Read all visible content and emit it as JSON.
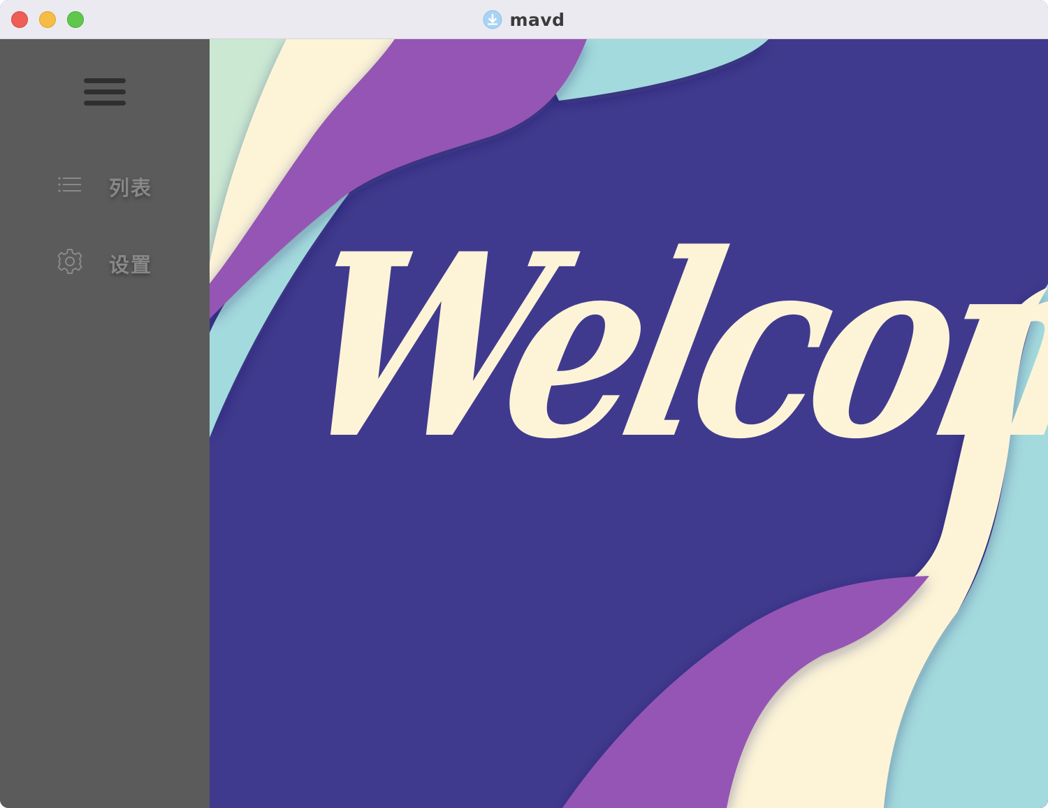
{
  "window": {
    "title": "mavd",
    "app_icon": "download-arrow-icon",
    "traffic_lights": [
      "close",
      "minimize",
      "zoom"
    ]
  },
  "sidebar": {
    "menu_icon": "hamburger-menu-icon",
    "items": [
      {
        "label": "列表",
        "icon": "list-icon"
      },
      {
        "label": "设置",
        "icon": "gear-icon"
      }
    ]
  },
  "main": {
    "welcome_text": "Welcome"
  },
  "colors": {
    "sidebar_bg": "#5b5b5b",
    "titlebar_bg": "#eceaf1",
    "content_bg": "#403a8e",
    "purple_wave": "#9554b4",
    "cream_wave": "#fdf4d8",
    "teal_wave": "#a3dadd",
    "mint_wave": "#cbe9d2"
  }
}
